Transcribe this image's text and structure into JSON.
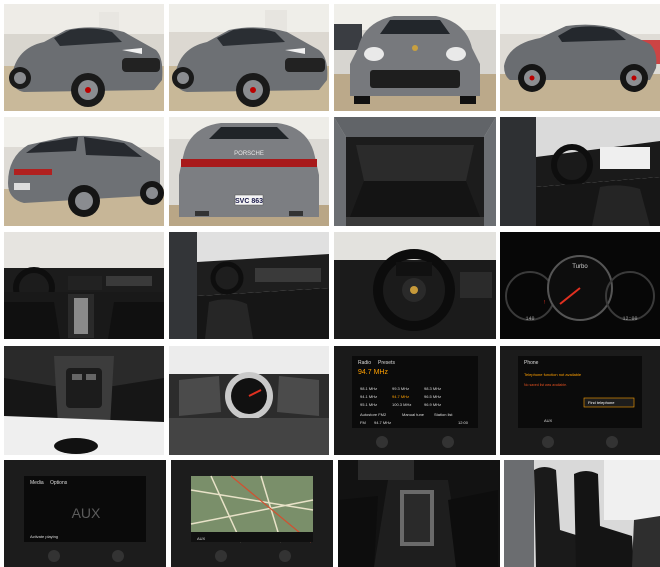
{
  "gallery": {
    "plate_text": "SVC 863",
    "badge_text": "PORSCHE",
    "screens": {
      "radio": {
        "tab1": "Radio",
        "tab2": "Presets",
        "freq_main": "94.7 MHz",
        "presets": [
          "98.1 MHz",
          "99.3 MHz",
          "98.3 MHz",
          "94.1 MHz",
          "94.7 MHz",
          "96.5 MHz",
          "95.1 MHz",
          "100.3 MHz",
          "96.9 MHz"
        ],
        "bottom": [
          "Autostore FM2",
          "Manual tune",
          "Station list"
        ],
        "status_left": "FM",
        "status_freq": "94.7 MHz",
        "time": "12:00"
      },
      "phone": {
        "tab": "Phone",
        "headline": "Telephone function not available",
        "body": "No saved list was available.",
        "button": "Find telephone",
        "aux": "AUX"
      },
      "media": {
        "tab1": "Media",
        "tab2": "Options",
        "source": "AUX",
        "status": "Activate playing"
      },
      "map": {
        "source": "AUX"
      },
      "gauge": {
        "temp": "140",
        "time": "12:00"
      }
    }
  }
}
